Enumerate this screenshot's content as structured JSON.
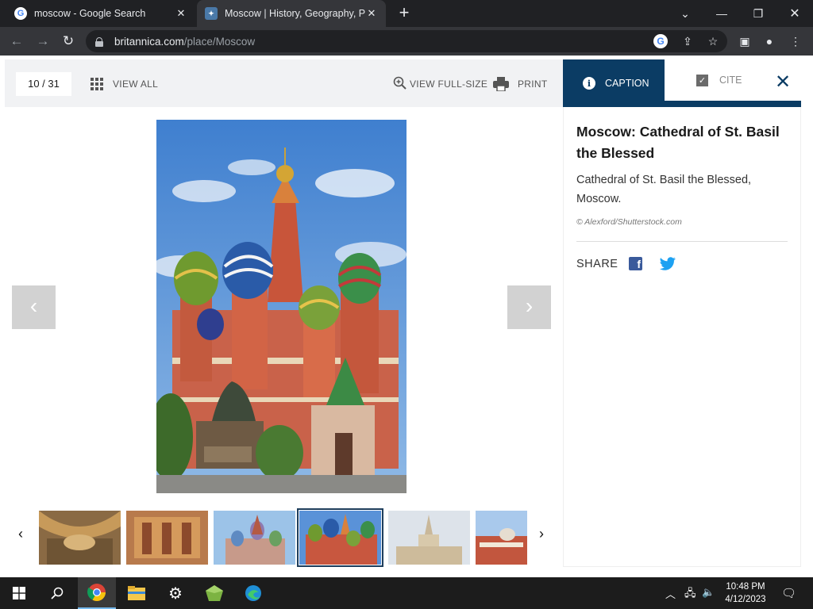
{
  "browser": {
    "tabs": [
      {
        "title": "moscow - Google Search",
        "favicon": "google-favicon",
        "active": false
      },
      {
        "title": "Moscow | History, Geography, Po",
        "favicon": "britannica-favicon",
        "active": true
      }
    ],
    "url_host": "britannica.com",
    "url_path": "/place/Moscow"
  },
  "viewer": {
    "counter": "10 / 31",
    "view_all": "VIEW ALL",
    "view_full_size": "VIEW FULL-SIZE",
    "print": "PRINT",
    "tab_caption": "CAPTION",
    "tab_cite": "CITE"
  },
  "caption": {
    "title": "Moscow: Cathedral of St. Basil the Blessed",
    "body": "Cathedral of St. Basil the Blessed, Moscow.",
    "credit": "© Alexford/Shutterstock.com",
    "share_label": "SHARE"
  },
  "thumbnails": {
    "count": 6,
    "selected_index": 3
  },
  "taskbar": {
    "time": "10:48 PM",
    "date": "4/12/2023"
  },
  "colors": {
    "accent": "#0b3c64",
    "facebook": "#3a5a9b",
    "twitter": "#1da1f2"
  }
}
